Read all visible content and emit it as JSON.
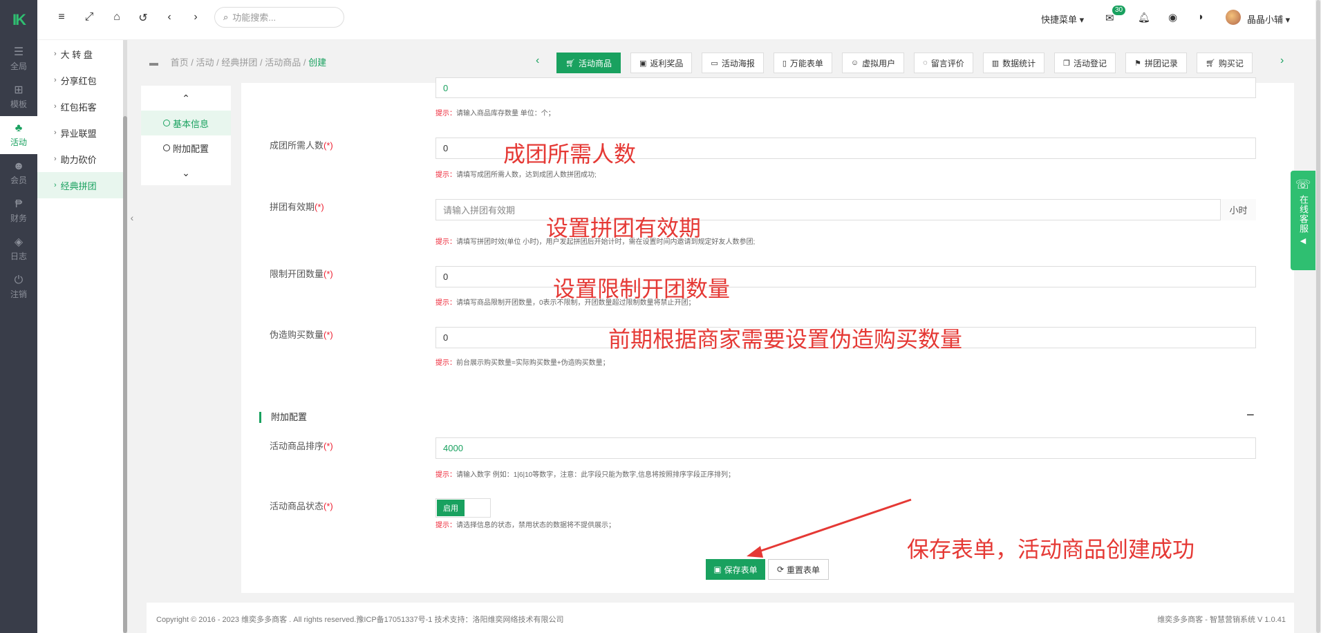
{
  "rail": {
    "logo": "IK",
    "items": [
      {
        "label": "全局",
        "icon": "sliders-icon"
      },
      {
        "label": "模板",
        "icon": "sitemap-icon"
      },
      {
        "label": "活动",
        "icon": "leaf-icon"
      },
      {
        "label": "会员",
        "icon": "users-icon"
      },
      {
        "label": "财务",
        "icon": "paypal-icon"
      },
      {
        "label": "日志",
        "icon": "shield-icon"
      },
      {
        "label": "注销",
        "icon": "power-icon"
      }
    ]
  },
  "sidebar": {
    "items": [
      {
        "label": "大 转 盘"
      },
      {
        "label": "分享红包"
      },
      {
        "label": "红包拓客"
      },
      {
        "label": "异业联盟"
      },
      {
        "label": "助力砍价"
      },
      {
        "label": "经典拼团"
      }
    ]
  },
  "topbar": {
    "search_placeholder": "功能搜索...",
    "quick_menu": "快捷菜单",
    "mail_badge": "30",
    "username": "晶晶小辅"
  },
  "breadcrumb": {
    "items": [
      "首页",
      "活动",
      "经典拼团",
      "活动商品"
    ],
    "current": "创建"
  },
  "tabs": [
    {
      "label": "活动商品",
      "icon": "cart-icon"
    },
    {
      "label": "返利奖品",
      "icon": "gift-icon"
    },
    {
      "label": "活动海报",
      "icon": "image-icon"
    },
    {
      "label": "万能表单",
      "icon": "file-icon"
    },
    {
      "label": "虚拟用户",
      "icon": "user-plus-icon"
    },
    {
      "label": "留言评价",
      "icon": "comment-icon"
    },
    {
      "label": "数据统计",
      "icon": "bar-chart-icon"
    },
    {
      "label": "活动登记",
      "icon": "copy-icon"
    },
    {
      "label": "拼团记录",
      "icon": "flag-icon"
    },
    {
      "label": "购买记",
      "icon": "cart-icon"
    }
  ],
  "secnav": {
    "items": [
      "基本信息",
      "附加配置"
    ]
  },
  "form": {
    "stock_value": "0",
    "stock_hint_prefix": "提示：",
    "stock_hint": "请输入商品库存数量 单位：个；",
    "group_size_label": "成团所需人数",
    "group_size_req": "(*)",
    "group_size_value": "0",
    "group_size_hint": "请填写成团所需人数，达到成团人数拼团成功;",
    "validity_label": "拼团有效期",
    "validity_req": "(*)",
    "validity_placeholder": "请输入拼团有效期",
    "validity_suffix": "小时",
    "validity_hint": "请填写拼团时效(单位 小时)，用户发起拼团后开始计时，需在设置时间内邀请到规定好友人数参团;",
    "limit_label": "限制开团数量",
    "limit_req": "(*)",
    "limit_value": "0",
    "limit_hint": "请填写商品限制开团数量，0表示不限制，开团数量超过限制数量将禁止开团；",
    "fake_label": "伪造购买数量",
    "fake_req": "(*)",
    "fake_value": "0",
    "fake_hint": "前台展示购买数量=实际购买数量+伪造购买数量；",
    "extra_section_title": "附加配置",
    "sort_label": "活动商品排序",
    "sort_req": "(*)",
    "sort_value": "4000",
    "sort_hint": "请输入数字 例如：1|6|10等数字，注意：此字段只能为数字,信息将按照排序字段正序排列；",
    "status_label": "活动商品状态",
    "status_req": "(*)",
    "status_on": "启用",
    "status_hint": "请选择信息的状态，禁用状态的数据将不提供展示；",
    "save_label": "保存表单",
    "reset_label": "重置表单"
  },
  "annotations": {
    "group_size": "成团所需人数",
    "validity": "设置拼团有效期",
    "limit": "设置限制开团数量",
    "fake": "前期根据商家需要设置伪造购买数量",
    "save": "保存表单，活动商品创建成功"
  },
  "footer": {
    "copyright": "Copyright © 2016 - 2023 维奕多多商客 . All rights reserved.豫ICP备17051337号-1 技术支持：洛阳维奕网络技术有限公司",
    "version": "维奕多多商客 - 智慧营销系统 V 1.0.41"
  },
  "kefu": {
    "label": "在线客服"
  },
  "colors": {
    "accent": "#19a15f",
    "rail_bg": "#393d49",
    "annotation": "#e53935",
    "required": "#ee2233"
  }
}
